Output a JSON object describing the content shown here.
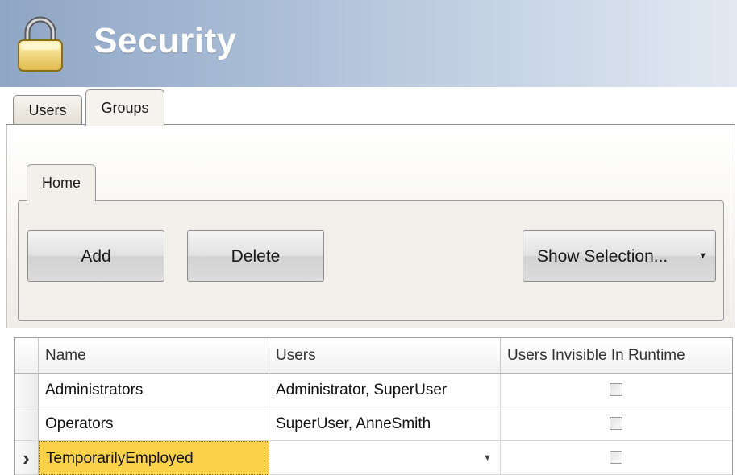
{
  "header": {
    "title": "Security",
    "icon": "lock-icon",
    "gradient_start": "#8fa6c4",
    "gradient_end": "#e2e9f2"
  },
  "tabs": [
    {
      "label": "Users",
      "active": false
    },
    {
      "label": "Groups",
      "active": true
    }
  ],
  "ribbon": {
    "tab_label": "Home",
    "buttons": {
      "add": "Add",
      "delete": "Delete",
      "show_selection": "Show Selection...",
      "show_selection_arrow": "▼"
    }
  },
  "grid": {
    "columns": [
      "Name",
      "Users",
      "Users Invisible In Runtime"
    ],
    "rows": [
      {
        "name": "Administrators",
        "users": "Administrator, SuperUser",
        "invisible": false
      },
      {
        "name": "Operators",
        "users": "SuperUser, AnneSmith",
        "invisible": false
      },
      {
        "name": "TemporarilyEmployed",
        "users": "",
        "invisible": false,
        "current": true
      }
    ],
    "current_row_marker": "›",
    "dropdown_arrow": "▼",
    "selected_color": "#f9d24a"
  }
}
